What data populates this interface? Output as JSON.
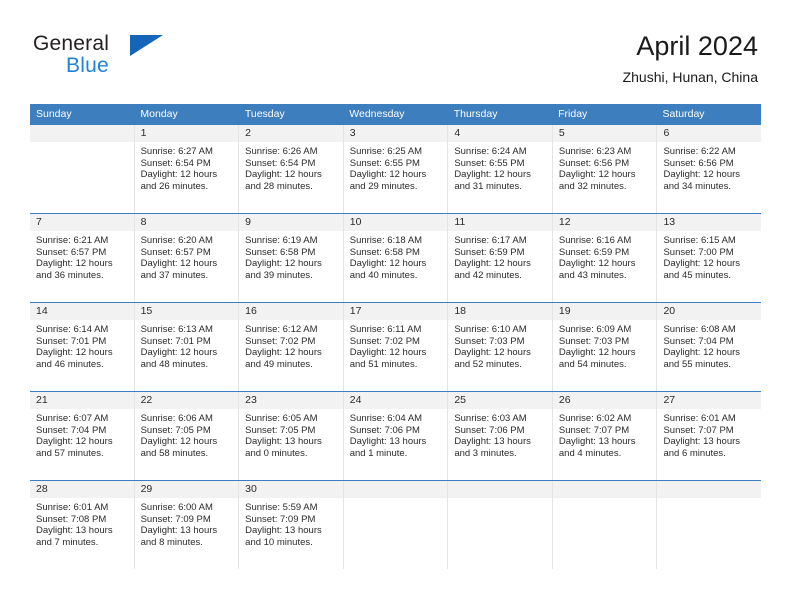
{
  "brand": {
    "name_part1": "General",
    "name_part2": "Blue",
    "accent_color": "#2183d6",
    "triangle_color": "#1565b8"
  },
  "header": {
    "title": "April 2024",
    "subtitle": "Zhushi, Hunan, China"
  },
  "theme": {
    "header_blue": "#3d7ebf",
    "day_band_gray": "#f2f2f2",
    "grid_line": "#e4e4e4"
  },
  "weekdays": [
    "Sunday",
    "Monday",
    "Tuesday",
    "Wednesday",
    "Thursday",
    "Friday",
    "Saturday"
  ],
  "weeks": [
    [
      {
        "day": "",
        "sunrise": "",
        "sunset": "",
        "daylight1": "",
        "daylight2": ""
      },
      {
        "day": "1",
        "sunrise": "Sunrise: 6:27 AM",
        "sunset": "Sunset: 6:54 PM",
        "daylight1": "Daylight: 12 hours",
        "daylight2": "and 26 minutes."
      },
      {
        "day": "2",
        "sunrise": "Sunrise: 6:26 AM",
        "sunset": "Sunset: 6:54 PM",
        "daylight1": "Daylight: 12 hours",
        "daylight2": "and 28 minutes."
      },
      {
        "day": "3",
        "sunrise": "Sunrise: 6:25 AM",
        "sunset": "Sunset: 6:55 PM",
        "daylight1": "Daylight: 12 hours",
        "daylight2": "and 29 minutes."
      },
      {
        "day": "4",
        "sunrise": "Sunrise: 6:24 AM",
        "sunset": "Sunset: 6:55 PM",
        "daylight1": "Daylight: 12 hours",
        "daylight2": "and 31 minutes."
      },
      {
        "day": "5",
        "sunrise": "Sunrise: 6:23 AM",
        "sunset": "Sunset: 6:56 PM",
        "daylight1": "Daylight: 12 hours",
        "daylight2": "and 32 minutes."
      },
      {
        "day": "6",
        "sunrise": "Sunrise: 6:22 AM",
        "sunset": "Sunset: 6:56 PM",
        "daylight1": "Daylight: 12 hours",
        "daylight2": "and 34 minutes."
      }
    ],
    [
      {
        "day": "7",
        "sunrise": "Sunrise: 6:21 AM",
        "sunset": "Sunset: 6:57 PM",
        "daylight1": "Daylight: 12 hours",
        "daylight2": "and 36 minutes."
      },
      {
        "day": "8",
        "sunrise": "Sunrise: 6:20 AM",
        "sunset": "Sunset: 6:57 PM",
        "daylight1": "Daylight: 12 hours",
        "daylight2": "and 37 minutes."
      },
      {
        "day": "9",
        "sunrise": "Sunrise: 6:19 AM",
        "sunset": "Sunset: 6:58 PM",
        "daylight1": "Daylight: 12 hours",
        "daylight2": "and 39 minutes."
      },
      {
        "day": "10",
        "sunrise": "Sunrise: 6:18 AM",
        "sunset": "Sunset: 6:58 PM",
        "daylight1": "Daylight: 12 hours",
        "daylight2": "and 40 minutes."
      },
      {
        "day": "11",
        "sunrise": "Sunrise: 6:17 AM",
        "sunset": "Sunset: 6:59 PM",
        "daylight1": "Daylight: 12 hours",
        "daylight2": "and 42 minutes."
      },
      {
        "day": "12",
        "sunrise": "Sunrise: 6:16 AM",
        "sunset": "Sunset: 6:59 PM",
        "daylight1": "Daylight: 12 hours",
        "daylight2": "and 43 minutes."
      },
      {
        "day": "13",
        "sunrise": "Sunrise: 6:15 AM",
        "sunset": "Sunset: 7:00 PM",
        "daylight1": "Daylight: 12 hours",
        "daylight2": "and 45 minutes."
      }
    ],
    [
      {
        "day": "14",
        "sunrise": "Sunrise: 6:14 AM",
        "sunset": "Sunset: 7:01 PM",
        "daylight1": "Daylight: 12 hours",
        "daylight2": "and 46 minutes."
      },
      {
        "day": "15",
        "sunrise": "Sunrise: 6:13 AM",
        "sunset": "Sunset: 7:01 PM",
        "daylight1": "Daylight: 12 hours",
        "daylight2": "and 48 minutes."
      },
      {
        "day": "16",
        "sunrise": "Sunrise: 6:12 AM",
        "sunset": "Sunset: 7:02 PM",
        "daylight1": "Daylight: 12 hours",
        "daylight2": "and 49 minutes."
      },
      {
        "day": "17",
        "sunrise": "Sunrise: 6:11 AM",
        "sunset": "Sunset: 7:02 PM",
        "daylight1": "Daylight: 12 hours",
        "daylight2": "and 51 minutes."
      },
      {
        "day": "18",
        "sunrise": "Sunrise: 6:10 AM",
        "sunset": "Sunset: 7:03 PM",
        "daylight1": "Daylight: 12 hours",
        "daylight2": "and 52 minutes."
      },
      {
        "day": "19",
        "sunrise": "Sunrise: 6:09 AM",
        "sunset": "Sunset: 7:03 PM",
        "daylight1": "Daylight: 12 hours",
        "daylight2": "and 54 minutes."
      },
      {
        "day": "20",
        "sunrise": "Sunrise: 6:08 AM",
        "sunset": "Sunset: 7:04 PM",
        "daylight1": "Daylight: 12 hours",
        "daylight2": "and 55 minutes."
      }
    ],
    [
      {
        "day": "21",
        "sunrise": "Sunrise: 6:07 AM",
        "sunset": "Sunset: 7:04 PM",
        "daylight1": "Daylight: 12 hours",
        "daylight2": "and 57 minutes."
      },
      {
        "day": "22",
        "sunrise": "Sunrise: 6:06 AM",
        "sunset": "Sunset: 7:05 PM",
        "daylight1": "Daylight: 12 hours",
        "daylight2": "and 58 minutes."
      },
      {
        "day": "23",
        "sunrise": "Sunrise: 6:05 AM",
        "sunset": "Sunset: 7:05 PM",
        "daylight1": "Daylight: 13 hours",
        "daylight2": "and 0 minutes."
      },
      {
        "day": "24",
        "sunrise": "Sunrise: 6:04 AM",
        "sunset": "Sunset: 7:06 PM",
        "daylight1": "Daylight: 13 hours",
        "daylight2": "and 1 minute."
      },
      {
        "day": "25",
        "sunrise": "Sunrise: 6:03 AM",
        "sunset": "Sunset: 7:06 PM",
        "daylight1": "Daylight: 13 hours",
        "daylight2": "and 3 minutes."
      },
      {
        "day": "26",
        "sunrise": "Sunrise: 6:02 AM",
        "sunset": "Sunset: 7:07 PM",
        "daylight1": "Daylight: 13 hours",
        "daylight2": "and 4 minutes."
      },
      {
        "day": "27",
        "sunrise": "Sunrise: 6:01 AM",
        "sunset": "Sunset: 7:07 PM",
        "daylight1": "Daylight: 13 hours",
        "daylight2": "and 6 minutes."
      }
    ],
    [
      {
        "day": "28",
        "sunrise": "Sunrise: 6:01 AM",
        "sunset": "Sunset: 7:08 PM",
        "daylight1": "Daylight: 13 hours",
        "daylight2": "and 7 minutes."
      },
      {
        "day": "29",
        "sunrise": "Sunrise: 6:00 AM",
        "sunset": "Sunset: 7:09 PM",
        "daylight1": "Daylight: 13 hours",
        "daylight2": "and 8 minutes."
      },
      {
        "day": "30",
        "sunrise": "Sunrise: 5:59 AM",
        "sunset": "Sunset: 7:09 PM",
        "daylight1": "Daylight: 13 hours",
        "daylight2": "and 10 minutes."
      },
      {
        "day": "",
        "sunrise": "",
        "sunset": "",
        "daylight1": "",
        "daylight2": ""
      },
      {
        "day": "",
        "sunrise": "",
        "sunset": "",
        "daylight1": "",
        "daylight2": ""
      },
      {
        "day": "",
        "sunrise": "",
        "sunset": "",
        "daylight1": "",
        "daylight2": ""
      },
      {
        "day": "",
        "sunrise": "",
        "sunset": "",
        "daylight1": "",
        "daylight2": ""
      }
    ]
  ]
}
